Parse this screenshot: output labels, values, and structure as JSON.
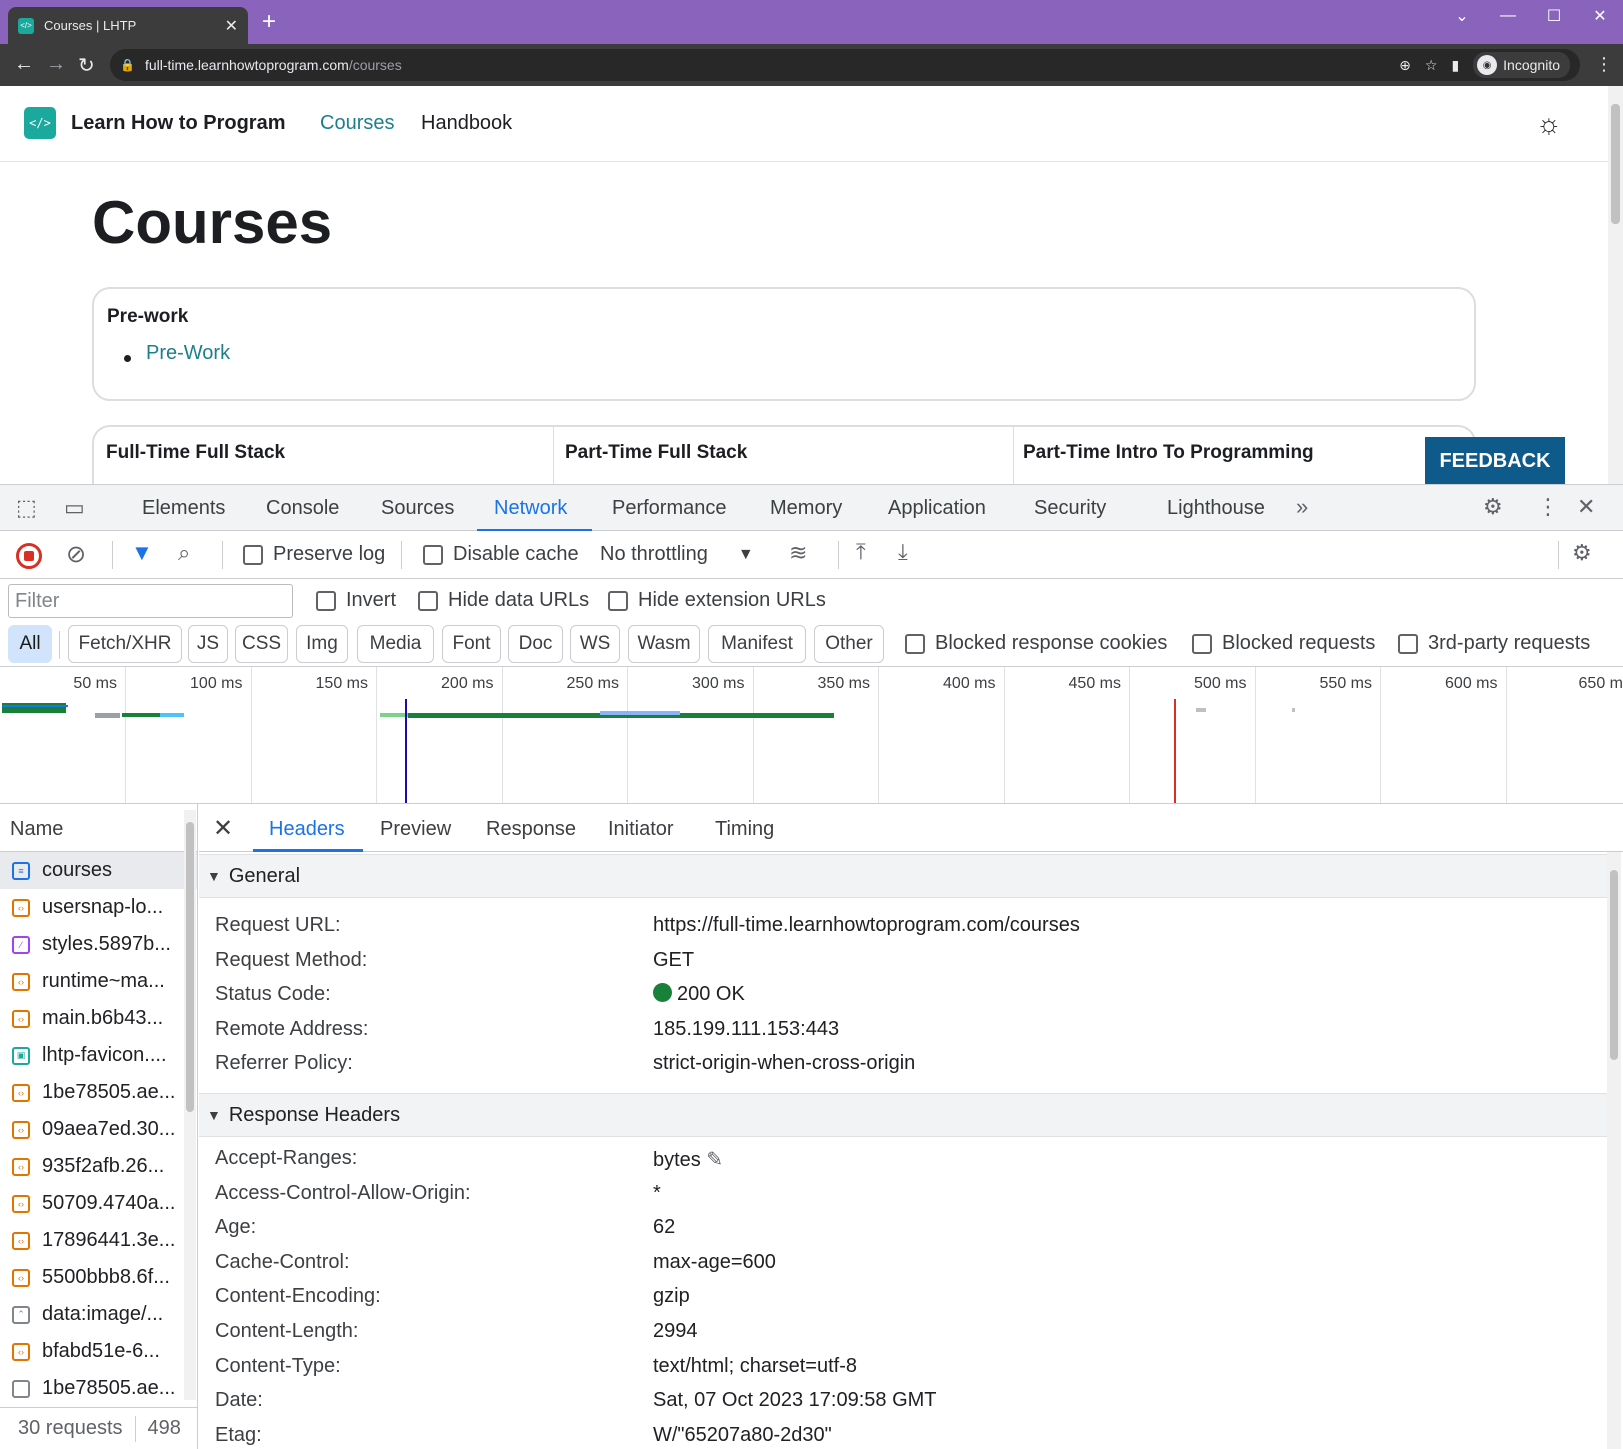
{
  "browser": {
    "tab_title": "Courses | LHTP",
    "tab_favicon": "</>",
    "url_host": "full-time.learnhowtoprogram.com",
    "url_path": "/courses",
    "profile_label": "Incognito"
  },
  "site": {
    "logo_glyph": "</>",
    "brand": "Learn How to Program",
    "nav": {
      "courses": "Courses",
      "handbook": "Handbook"
    },
    "page_title": "Courses",
    "prework": {
      "title": "Pre-work",
      "link": "Pre-Work"
    },
    "tracks": [
      "Full-Time Full Stack",
      "Part-Time Full Stack",
      "Part-Time Intro To Programming"
    ],
    "feedback": "FEEDBACK",
    "colors": {
      "accent": "#1c7f8c",
      "feedback_bg": "#0e5a8a"
    }
  },
  "devtools": {
    "tabs": [
      "Elements",
      "Console",
      "Sources",
      "Network",
      "Performance",
      "Memory",
      "Application",
      "Security",
      "Lighthouse"
    ],
    "active_tab": "Network",
    "toolbar": {
      "preserve_log": "Preserve log",
      "disable_cache": "Disable cache",
      "throttling": "No throttling"
    },
    "filter": {
      "placeholder": "Filter",
      "invert": "Invert",
      "hide_data_urls": "Hide data URLs",
      "hide_extension_urls": "Hide extension URLs"
    },
    "type_filters": [
      "All",
      "Fetch/XHR",
      "JS",
      "CSS",
      "Img",
      "Media",
      "Font",
      "Doc",
      "WS",
      "Wasm",
      "Manifest",
      "Other"
    ],
    "extra_filters": {
      "blocked_cookies": "Blocked response cookies",
      "blocked_requests": "Blocked requests",
      "third_party": "3rd-party requests"
    },
    "timeline_ticks": [
      "50 ms",
      "100 ms",
      "150 ms",
      "200 ms",
      "250 ms",
      "300 ms",
      "350 ms",
      "400 ms",
      "450 ms",
      "500 ms",
      "550 ms",
      "600 ms",
      "650 m"
    ],
    "requests_header": "Name",
    "requests": [
      {
        "name": "courses",
        "type": "doc"
      },
      {
        "name": "usersnap-lo...",
        "type": "js"
      },
      {
        "name": "styles.5897b...",
        "type": "css"
      },
      {
        "name": "runtime~ma...",
        "type": "js"
      },
      {
        "name": "main.b6b43...",
        "type": "js"
      },
      {
        "name": "lhtp-favicon....",
        "type": "img"
      },
      {
        "name": "1be78505.ae...",
        "type": "js"
      },
      {
        "name": "09aea7ed.30...",
        "type": "js"
      },
      {
        "name": "935f2afb.26...",
        "type": "js"
      },
      {
        "name": "50709.4740a...",
        "type": "js"
      },
      {
        "name": "17896441.3e...",
        "type": "js"
      },
      {
        "name": "5500bbb8.6f...",
        "type": "js"
      },
      {
        "name": "data:image/...",
        "type": "img-gen"
      },
      {
        "name": "bfabd51e-6...",
        "type": "js"
      },
      {
        "name": "1be78505.ae...",
        "type": "other"
      }
    ],
    "status": {
      "requests": "30 requests",
      "transferred": "498"
    },
    "detail_tabs": [
      "Headers",
      "Preview",
      "Response",
      "Initiator",
      "Timing"
    ],
    "general": {
      "title": "General",
      "rows": [
        {
          "k": "Request URL:",
          "v": "https://full-time.learnhowtoprogram.com/courses"
        },
        {
          "k": "Request Method:",
          "v": "GET"
        },
        {
          "k": "Status Code:",
          "v": "200 OK"
        },
        {
          "k": "Remote Address:",
          "v": "185.199.111.153:443"
        },
        {
          "k": "Referrer Policy:",
          "v": "strict-origin-when-cross-origin"
        }
      ]
    },
    "response_headers": {
      "title": "Response Headers",
      "rows": [
        {
          "k": "Accept-Ranges:",
          "v": "bytes"
        },
        {
          "k": "Access-Control-Allow-Origin:",
          "v": "*"
        },
        {
          "k": "Age:",
          "v": "62"
        },
        {
          "k": "Cache-Control:",
          "v": "max-age=600"
        },
        {
          "k": "Content-Encoding:",
          "v": "gzip"
        },
        {
          "k": "Content-Length:",
          "v": "2994"
        },
        {
          "k": "Content-Type:",
          "v": "text/html; charset=utf-8"
        },
        {
          "k": "Date:",
          "v": "Sat, 07 Oct 2023 17:09:58 GMT"
        },
        {
          "k": "Etag:",
          "v": "W/\"65207a80-2d30\""
        }
      ]
    },
    "colors": {
      "accent": "#1a73e8",
      "record": "#d93025",
      "status_ok": "#188038"
    }
  }
}
